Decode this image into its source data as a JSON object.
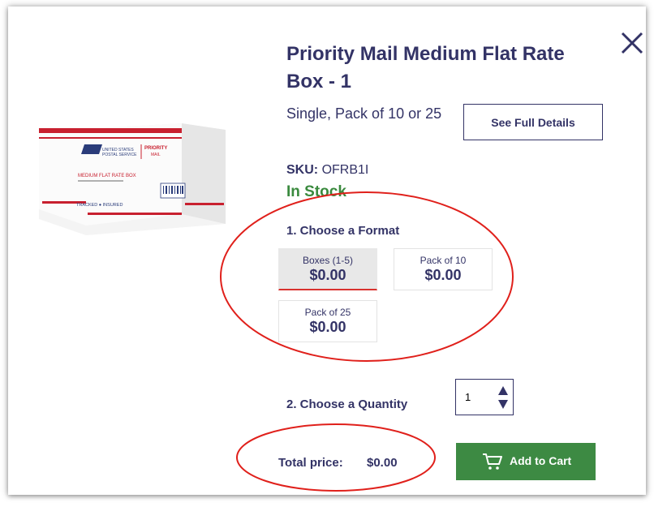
{
  "product": {
    "title": "Priority Mail Medium Flat Rate Box - 1",
    "subtitle": "Single, Pack of 10 or 25",
    "details_label": "See Full Details",
    "sku_label": "SKU:",
    "sku_value": "OFRB1I",
    "stock": "In Stock",
    "image_text": {
      "agency_line1": "UNITED STATES",
      "agency_line2": "POSTAL SERVICE",
      "brand_line1": "PRIORITY",
      "brand_line2": "MAIL",
      "box_name": "MEDIUM FLAT RATE BOX",
      "tracked": "TRACKED ● INSURED"
    }
  },
  "format": {
    "heading": "1. Choose a Format",
    "options": [
      {
        "label": "Boxes (1-5)",
        "price": "$0.00",
        "selected": true
      },
      {
        "label": "Pack of 10",
        "price": "$0.00",
        "selected": false
      },
      {
        "label": "Pack of 25",
        "price": "$0.00",
        "selected": false
      }
    ]
  },
  "quantity": {
    "heading": "2. Choose a Quantity",
    "value": "1"
  },
  "total": {
    "label": "Total price:",
    "value": "$0.00"
  },
  "cart": {
    "label": "Add to Cart"
  },
  "colors": {
    "navy": "#333366",
    "in_stock_green": "#3a8a3e",
    "cart_green": "#3d8a43",
    "annotation_red": "#e0201b"
  },
  "icons": [
    "close-icon",
    "cart-icon",
    "stepper-arrows-icon"
  ]
}
